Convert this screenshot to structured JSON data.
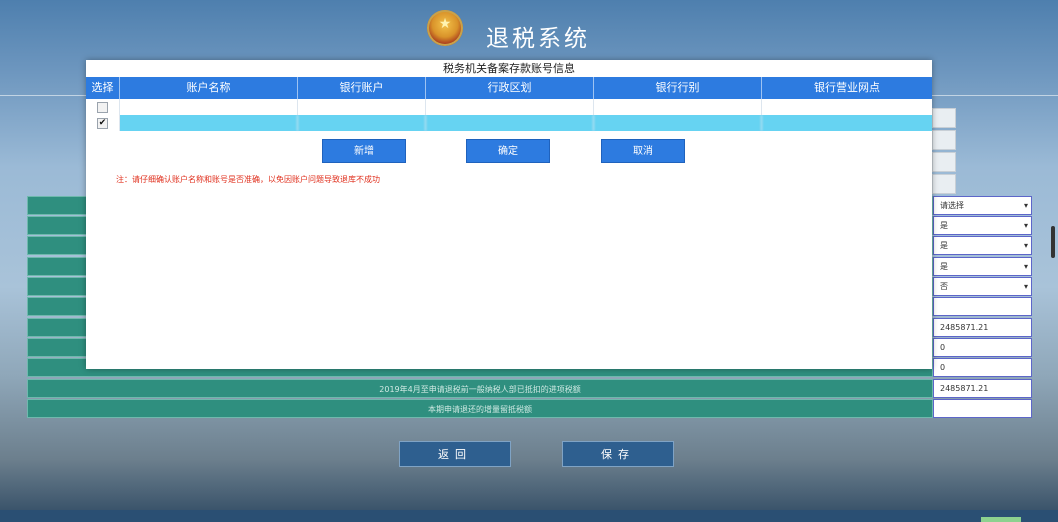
{
  "header": {
    "title": "退税系统"
  },
  "form": {
    "rows": [
      {
        "label": "",
        "value": "请选择",
        "select": true
      },
      {
        "label": "",
        "value": "是",
        "select": true
      },
      {
        "label": "",
        "value": "是",
        "select": true
      },
      {
        "label": "",
        "value": "是",
        "select": true
      },
      {
        "label": "",
        "value": "否",
        "select": true
      },
      {
        "label": "",
        "value": "",
        "select": false
      },
      {
        "label": "",
        "value": "2485871.21",
        "select": false
      },
      {
        "label": "",
        "value": "0",
        "select": false
      },
      {
        "label": "",
        "value": "0",
        "select": false
      },
      {
        "label": "2019年4月至申请退税前一般纳税人部已抵扣的进项税额",
        "value": "2485871.21",
        "select": false
      },
      {
        "label": "本期申请退还的增量留抵税额",
        "value": "",
        "select": false
      }
    ],
    "back_label": "返回",
    "save_label": "保存"
  },
  "modal": {
    "title": "税务机关备案存款账号信息",
    "columns": [
      "选择",
      "账户名称",
      "银行账户",
      "行政区划",
      "银行行别",
      "银行营业网点"
    ],
    "rows": [
      {
        "checked": false,
        "selected": false
      },
      {
        "checked": true,
        "selected": true
      }
    ],
    "add_label": "新增",
    "confirm_label": "确定",
    "cancel_label": "取消",
    "note": "注：请仔细确认账户名称和账号是否准确，以免因账户问题导致退库不成功"
  }
}
